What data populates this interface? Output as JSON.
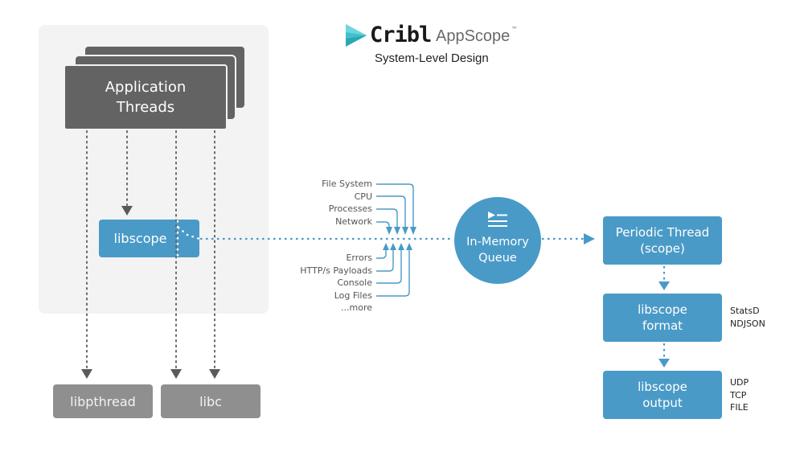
{
  "header": {
    "brand": "Cribl",
    "product": "AppScope",
    "trademark": "™",
    "subtitle": "System-Level Design",
    "logo_icon": "cribl-logo-icon"
  },
  "colors": {
    "accent_blue": "#4a9ac7",
    "dark_gray": "#636363",
    "medium_gray": "#8f8f8f",
    "panel_bg": "#f3f3f3",
    "logo_teal": "#3fc1c9"
  },
  "app_threads": {
    "line1": "Application",
    "line2": "Threads"
  },
  "libscope": {
    "label": "libscope"
  },
  "system_libs": [
    {
      "label": "libpthread"
    },
    {
      "label": "libc"
    }
  ],
  "inputs_top": [
    "File System",
    "CPU",
    "Processes",
    "Network"
  ],
  "inputs_bottom": [
    "Errors",
    "HTTP/s Payloads",
    "Console",
    "Log Files"
  ],
  "inputs_more": "...more",
  "queue": {
    "line1": "In-Memory",
    "line2": "Queue",
    "icon": "queue-icon"
  },
  "pipeline": [
    {
      "line1": "Periodic Thread",
      "line2": "(scope)",
      "notes": []
    },
    {
      "line1": "libscope",
      "line2": "format",
      "notes": [
        "StatsD",
        "NDJSON"
      ]
    },
    {
      "line1": "libscope",
      "line2": "output",
      "notes": [
        "UDP",
        "TCP",
        "FILE"
      ]
    }
  ]
}
